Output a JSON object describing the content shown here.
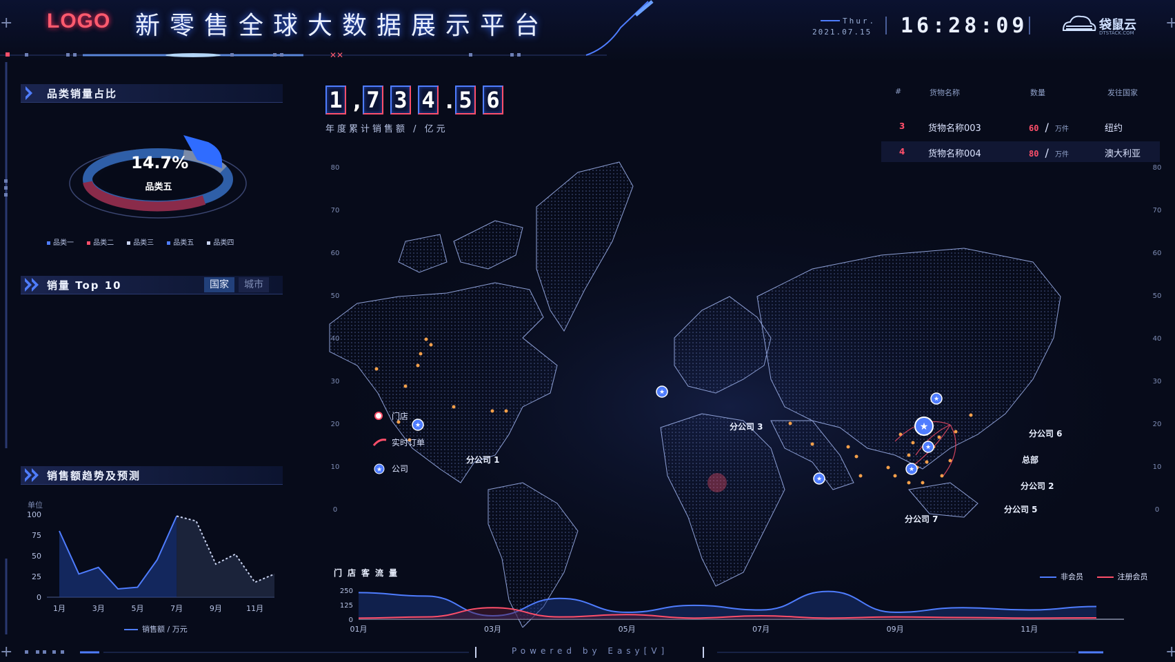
{
  "header": {
    "logo": "LOGO",
    "title": "新零售全球大数据展示平台",
    "day": "Thur.",
    "date": "2021.07.15",
    "time": "16:28:09",
    "brand": "袋鼠云",
    "brand_sub": "DTSTACK.COM"
  },
  "category_panel": {
    "title": "品类销量占比",
    "percent": "14.7%",
    "selected_label": "品类五",
    "legend": [
      {
        "label": "品类一",
        "color": "#4f7dff"
      },
      {
        "label": "品类二",
        "color": "#ff4f6a"
      },
      {
        "label": "品类三",
        "color": "#c9d3f0"
      },
      {
        "label": "品类五",
        "color": "#4f7dff"
      },
      {
        "label": "品类四",
        "color": "#c9d3f0"
      }
    ]
  },
  "top10_panel": {
    "title": "销量 Top 10",
    "tabs": [
      {
        "label": "国家",
        "active": true
      },
      {
        "label": "城市",
        "active": false
      }
    ]
  },
  "trend_panel": {
    "title": "销售额趋势及预测",
    "unit_label": "单位",
    "legend_label": "销售额 / 万元",
    "chart_data": {
      "type": "area",
      "x": [
        "1月",
        "2月",
        "3月",
        "4月",
        "5月",
        "6月",
        "7月",
        "8月",
        "9月",
        "10月",
        "11月",
        "12月"
      ],
      "xticks": [
        "1月",
        "3月",
        "5月",
        "7月",
        "9月",
        "11月"
      ],
      "yticks": [
        0,
        25,
        50,
        75,
        100
      ],
      "ylim": [
        0,
        100
      ],
      "series": [
        {
          "name": "销售额 / 万元",
          "values": [
            80,
            28,
            36,
            10,
            12,
            45,
            98,
            null,
            null,
            null,
            null,
            null
          ]
        },
        {
          "values": [
            null,
            null,
            null,
            null,
            null,
            null,
            98,
            92,
            40,
            52,
            18,
            28
          ]
        }
      ]
    }
  },
  "kpi": {
    "chars": [
      "1",
      ",",
      "7",
      "3",
      "4",
      ".",
      "5",
      "6"
    ],
    "label": "年度累计销售额 / 亿元"
  },
  "goods_table": {
    "headers": [
      "#",
      "货物名称",
      "数量",
      "发往国家"
    ],
    "rows": [
      {
        "rank": "3",
        "name": "货物名称003",
        "qty": "60",
        "slash": "/",
        "unit": "万件",
        "country": "纽约"
      },
      {
        "rank": "4",
        "name": "货物名称004",
        "qty": "80",
        "slash": "/",
        "unit": "万件",
        "country": "澳大利亚"
      }
    ]
  },
  "map": {
    "yticks": [
      "80",
      "70",
      "60",
      "50",
      "40",
      "30",
      "20",
      "10",
      "0"
    ],
    "legend": [
      {
        "label": "门店"
      },
      {
        "label": "实时订单"
      },
      {
        "label": "公司"
      }
    ],
    "companies": [
      {
        "label": "分公司 1"
      },
      {
        "label": "分公司 3"
      },
      {
        "label": "分公司 6"
      },
      {
        "label": "总部"
      },
      {
        "label": "分公司 2"
      },
      {
        "label": "分公司 5"
      },
      {
        "label": "分公司 7"
      }
    ]
  },
  "traffic_chart": {
    "title": "门店客流量",
    "legend": [
      {
        "label": "非会员",
        "color": "#4f7dff"
      },
      {
        "label": "注册会员",
        "color": "#ff4f6a"
      }
    ],
    "chart_data": {
      "type": "line",
      "x": [
        "01月",
        "02月",
        "03月",
        "04月",
        "05月",
        "06月",
        "07月",
        "08月",
        "09月",
        "10月",
        "11月",
        "12月"
      ],
      "xticks": [
        "01月",
        "03月",
        "05月",
        "07月",
        "09月",
        "11月"
      ],
      "yticks": [
        0,
        125,
        250
      ],
      "ylim": [
        0,
        250
      ],
      "series": [
        {
          "name": "非会员",
          "values": [
            230,
            200,
            30,
            180,
            60,
            120,
            80,
            240,
            60,
            100,
            80,
            110
          ]
        },
        {
          "name": "注册会员",
          "values": [
            10,
            20,
            100,
            20,
            40,
            10,
            30,
            10,
            20,
            15,
            10,
            12
          ]
        }
      ]
    }
  },
  "footer": {
    "powered": "Powered by Easy[V]"
  }
}
